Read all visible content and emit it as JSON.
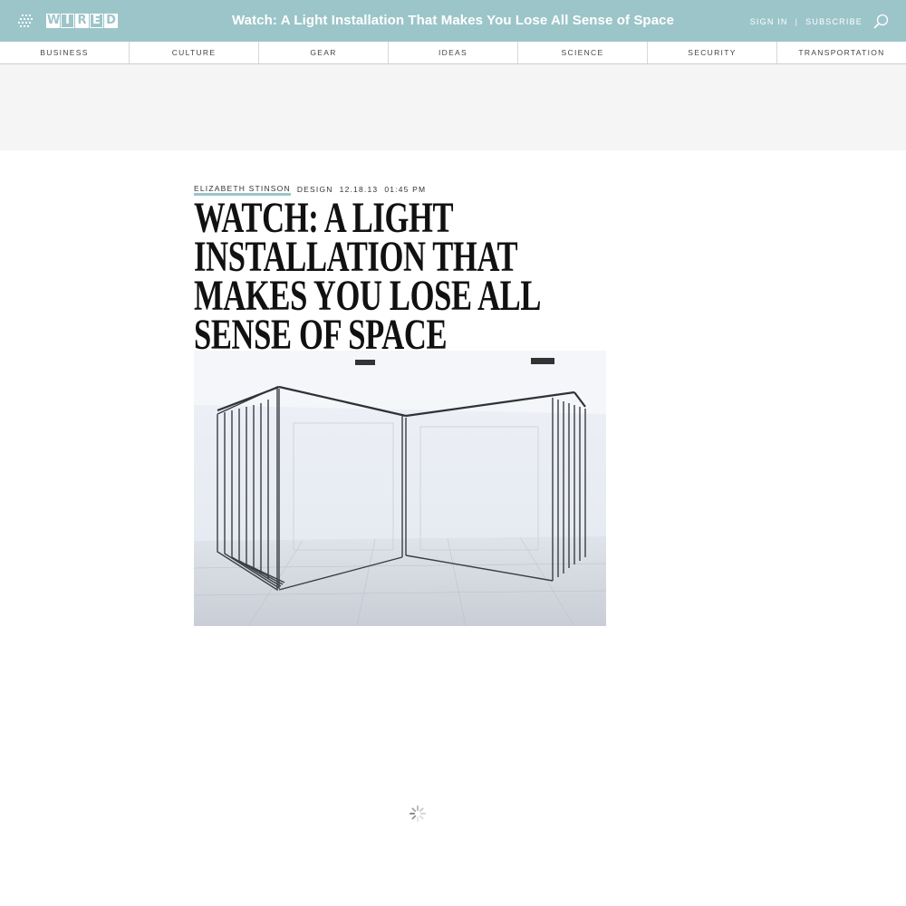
{
  "header": {
    "logo_letters": [
      "W",
      "I",
      "R",
      "E",
      "D"
    ],
    "title": "Watch: A Light Installation That Makes You Lose All Sense of Space",
    "sign_in": "SIGN IN",
    "separator": "|",
    "subscribe": "SUBSCRIBE",
    "bar_color": "#9cc5c9"
  },
  "nav": {
    "items": [
      "BUSINESS",
      "CULTURE",
      "GEAR",
      "IDEAS",
      "SCIENCE",
      "SECURITY",
      "TRANSPORTATION"
    ]
  },
  "article": {
    "author": "ELIZABETH STINSON",
    "category": "DESIGN",
    "date": "12.18.13",
    "time": "01:45 PM",
    "headline": "Watch: A Light Installation That Makes You Lose All Sense of Space"
  },
  "icons": {
    "menu": "grid-menu-icon",
    "search": "search-icon",
    "loading": "loading-spinner-icon"
  }
}
